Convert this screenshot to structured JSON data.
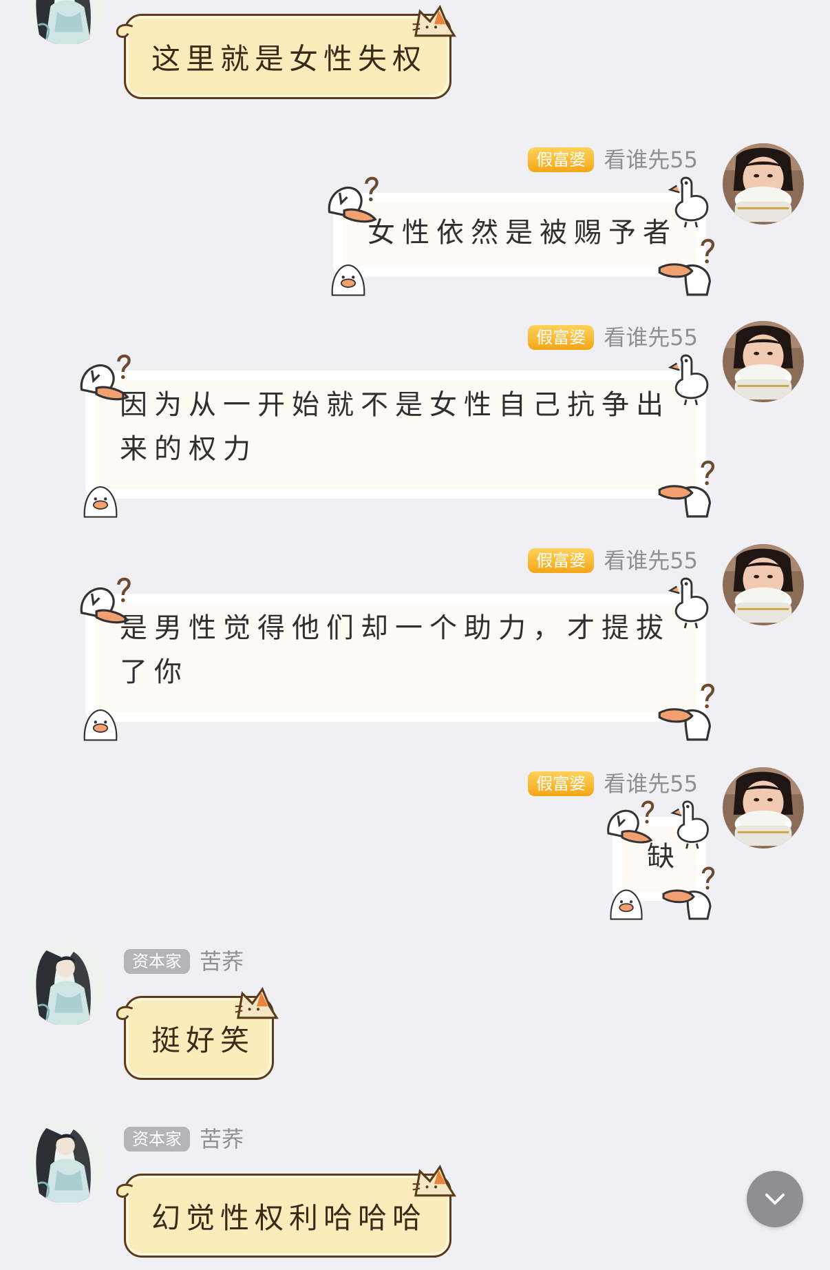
{
  "messages": [
    {
      "sender": "left",
      "text": "这里就是女性失权"
    },
    {
      "sender": "right",
      "badge": "假富婆",
      "nick": "看谁先55",
      "text": "女性依然是被赐予者"
    },
    {
      "sender": "right",
      "badge": "假富婆",
      "nick": "看谁先55",
      "text_line1": "因为从一开始就不是女性自己抗争出",
      "text_line2": "来的权力"
    },
    {
      "sender": "right",
      "badge": "假富婆",
      "nick": "看谁先55",
      "text_line1": "是男性觉得他们却一个助力，才提拔",
      "text_line2": "了你"
    },
    {
      "sender": "right",
      "badge": "假富婆",
      "nick": "看谁先55",
      "text": "缺"
    },
    {
      "sender": "left",
      "badge": "资本家",
      "nick": "苦荞",
      "text": "挺好笑"
    },
    {
      "sender": "left",
      "badge": "资本家",
      "nick": "苦荞",
      "text": "幻觉性权利哈哈哈"
    }
  ],
  "colors": {
    "background": "#efeff4",
    "gold_badge": "#f3a618",
    "grey_badge": "#b3b3b8",
    "cat_bubble_fill": "#fdecbb",
    "cat_bubble_border": "#5a3b1c"
  },
  "icons": {
    "scroll_button": "chevron-down-icon"
  }
}
